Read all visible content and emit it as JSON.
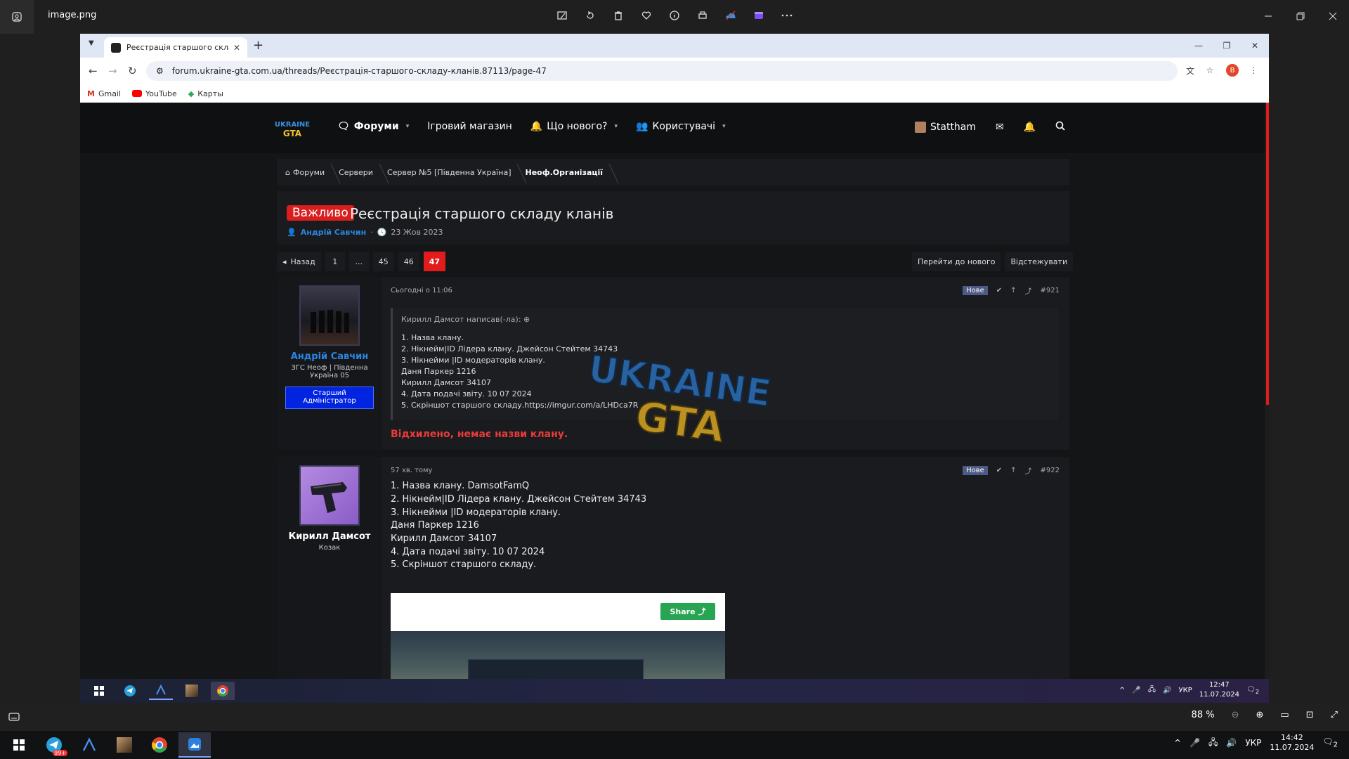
{
  "viewer": {
    "title": "image.png",
    "zoom": "88 %"
  },
  "browser": {
    "tab_title": "Реєстрація старшого складу кл...",
    "url": "forum.ukraine-gta.com.ua/threads/Реєстрація-старшого-складу-кланів.87113/page-47",
    "profile_letter": "B",
    "bookmarks": [
      "Gmail",
      "YouTube",
      "Карты"
    ]
  },
  "site": {
    "logo_text": "UKRAINE GTA",
    "nav": [
      "Форуми",
      "Ігровий магазин",
      "Що нового?",
      "Користувачі"
    ],
    "username": "Stattham",
    "breadcrumbs": [
      "Форуми",
      "Сервери",
      "Сервер №5 [Південна Україна]",
      "Неоф.Організації"
    ],
    "thread": {
      "badge": "Важливо",
      "title": "Реєстрація старшого складу кланів",
      "author": "Андрій Савчин",
      "date": "23 Жов 2023"
    },
    "pager": {
      "back": "Назад",
      "pages": [
        "1",
        "...",
        "45",
        "46",
        "47"
      ],
      "go_new": "Перейти до нового",
      "watch": "Відстежувати"
    },
    "post1": {
      "author": "Андрій Савчин",
      "title": "ЗГС Неоф | Південна Україна 05",
      "banner": "Старший Адміністратор",
      "date": "Сьогодні о 11:06",
      "new": "Нове",
      "number": "#921",
      "quote_head": "Кирилл Дамсот написав(-ла):",
      "quote_lines": [
        "1. Назва клану.",
        "2. Нікнейм|ID Лідера клану. Джейсон Стейтем 34743",
        "3. Нікнейми |ID модераторів клану.",
        "Даня Паркер 1216",
        "Кирилл Дамсот 34107",
        "4. Дата подачі звіту. 10 07 2024",
        "5. Скріншот старшого складу.https://imgur.com/a/LHDca7R"
      ],
      "verdict": "Відхилено, немає назви клану."
    },
    "post2": {
      "author": "Кирилл Дамсот",
      "title": "Козак",
      "date": "57 хв. тому",
      "new": "Нове",
      "number": "#922",
      "lines": [
        "1. Назва клану. DamsotFamQ",
        "2. Нікнейм|ID Лідера клану. Джейсон Стейтем 34743",
        "3. Нікнейми |ID модераторів клану.",
        "Даня Паркер 1216",
        "Кирилл Дамсот 34107",
        "4. Дата подачі звіту. 10 07 2024",
        "5. Скріншот старшого складу."
      ],
      "share": "Share"
    }
  },
  "inner_taskbar": {
    "lang": "УКР",
    "time": "12:47",
    "date": "11.07.2024",
    "notif": "2"
  },
  "taskbar": {
    "lang": "УКР",
    "time": "14:42",
    "date": "11.07.2024",
    "telegram_badge": "99+",
    "notif": "2"
  },
  "colors": {
    "accent_red": "#e21c1c",
    "link_blue": "#2a86e2",
    "banner_blue": "#0024e0",
    "reject_red": "#ea3b3b"
  }
}
